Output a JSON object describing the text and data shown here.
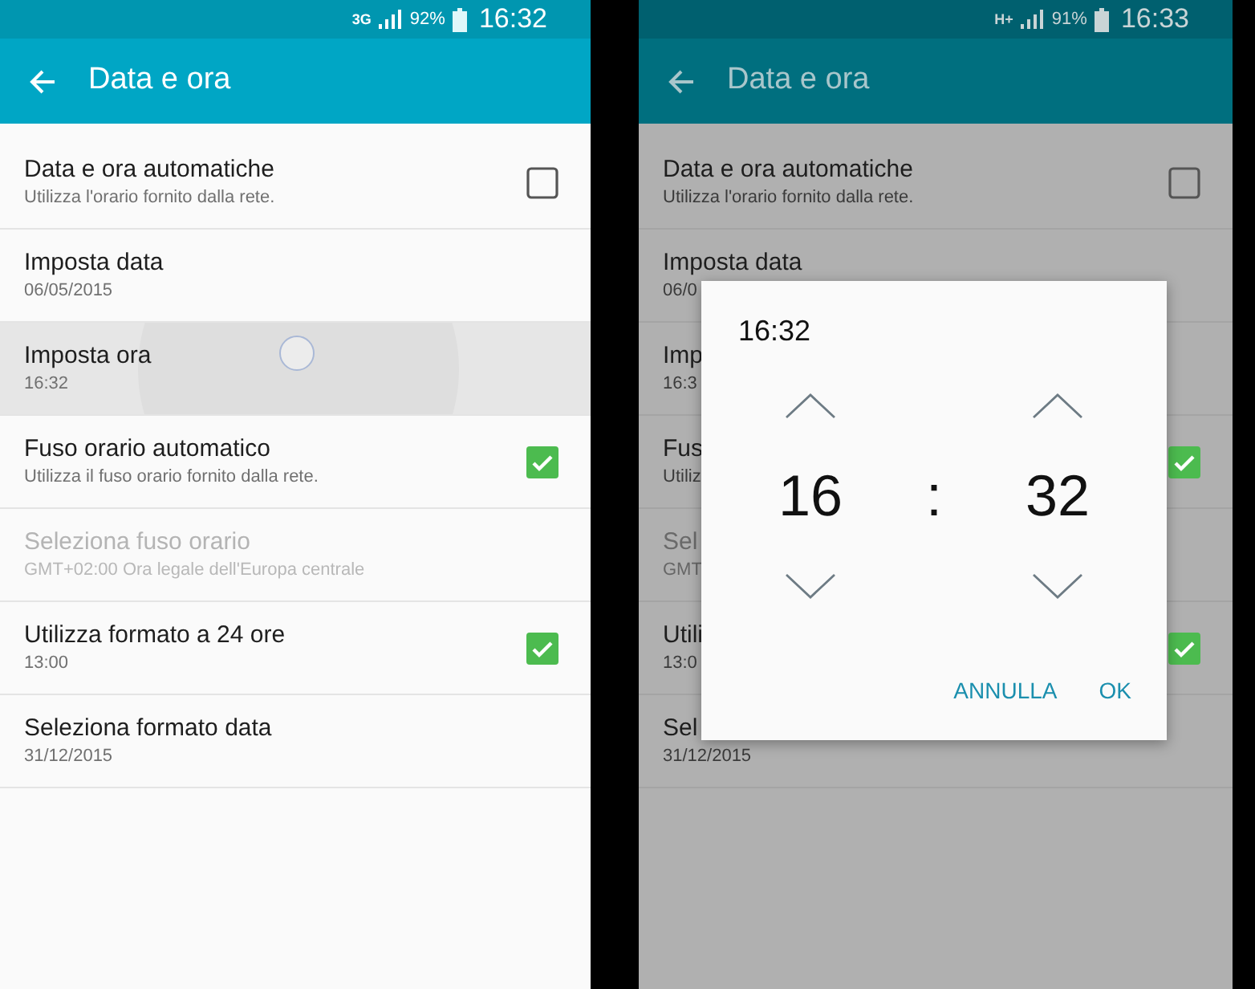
{
  "screens": [
    {
      "dimmed": false,
      "status_bar": {
        "network": "3G",
        "battery": "92%",
        "time": "16:32"
      },
      "app_bar": {
        "title": "Data e ora"
      },
      "settings": [
        {
          "kind": "checkbox",
          "title": "Data e ora automatiche",
          "summary": "Utilizza l'orario fornito dalla rete.",
          "checked": false,
          "disabled": false,
          "pressed": false
        },
        {
          "kind": "plain",
          "title": "Imposta data",
          "summary": "06/05/2015",
          "disabled": false,
          "pressed": false
        },
        {
          "kind": "plain",
          "title": "Imposta ora",
          "summary": "16:32",
          "disabled": false,
          "pressed": true
        },
        {
          "kind": "checkbox",
          "title": "Fuso orario automatico",
          "summary": "Utilizza il fuso orario fornito dalla rete.",
          "checked": true,
          "disabled": false,
          "pressed": false
        },
        {
          "kind": "plain",
          "title": "Seleziona fuso orario",
          "summary": "GMT+02:00 Ora legale dell'Europa centrale",
          "disabled": true,
          "pressed": false
        },
        {
          "kind": "checkbox",
          "title": "Utilizza formato a 24 ore",
          "summary": "13:00",
          "checked": true,
          "disabled": false,
          "pressed": false
        },
        {
          "kind": "plain",
          "title": "Seleziona formato data",
          "summary": "31/12/2015",
          "disabled": false,
          "pressed": false
        }
      ]
    },
    {
      "dimmed": true,
      "status_bar": {
        "network": "H+",
        "battery": "91%",
        "time": "16:33"
      },
      "app_bar": {
        "title": "Data e ora"
      },
      "settings": [
        {
          "kind": "checkbox",
          "title": "Data e ora automatiche",
          "summary": "Utilizza l'orario fornito dalla rete.",
          "checked": false,
          "disabled": false,
          "pressed": false
        },
        {
          "kind": "plain",
          "title": "Imposta data",
          "summary": "06/0",
          "disabled": false,
          "pressed": false
        },
        {
          "kind": "plain",
          "title": "Imp",
          "summary": "16:3",
          "disabled": false,
          "pressed": false
        },
        {
          "kind": "checkbox",
          "title": "Fus",
          "summary": "Utiliz",
          "checked": true,
          "disabled": false,
          "pressed": false
        },
        {
          "kind": "plain",
          "title": "Sel",
          "summary": "GMT",
          "disabled": true,
          "pressed": false
        },
        {
          "kind": "checkbox",
          "title": "Utili",
          "summary": "13:0",
          "checked": true,
          "disabled": false,
          "pressed": false
        },
        {
          "kind": "plain",
          "title": "Sel",
          "summary": "31/12/2015",
          "disabled": false,
          "pressed": false
        }
      ],
      "dialog": {
        "title": "16:32",
        "hour": "16",
        "separator": ":",
        "minute": "32",
        "buttons": [
          "ANNULLA",
          "OK"
        ]
      }
    }
  ]
}
